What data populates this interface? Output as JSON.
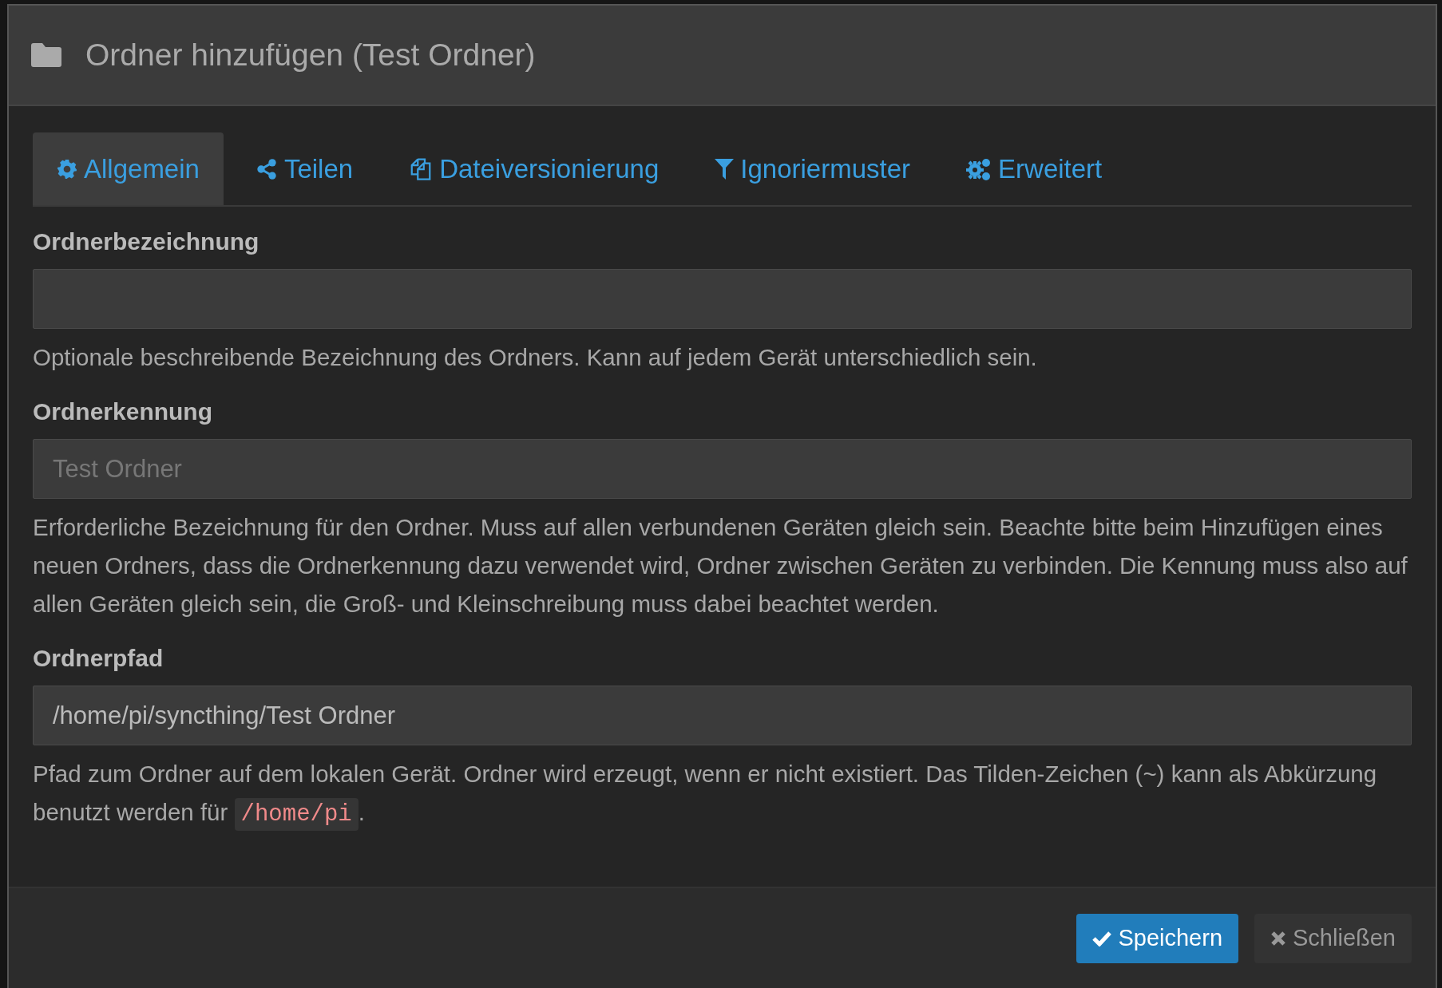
{
  "dialog": {
    "title": "Ordner hinzufügen (Test Ordner)"
  },
  "tabs": [
    {
      "label": "Allgemein",
      "kind": "gear",
      "selected": true
    },
    {
      "label": "Teilen",
      "kind": "share",
      "selected": false
    },
    {
      "label": "Dateiversionierung",
      "kind": "copies",
      "selected": false
    },
    {
      "label": "Ignoriermuster",
      "kind": "filter",
      "selected": false
    },
    {
      "label": "Erweitert",
      "kind": "gears",
      "selected": false
    }
  ],
  "fields": [
    {
      "label": "Ordnerbezeichnung",
      "help": "Optionale beschreibende Bezeichnung des Ordners. Kann auf jedem Gerät unterschiedlich sein."
    },
    {
      "label": "Ordnerkennung",
      "placeholder": "Test Ordner",
      "help": "Erforderliche Bezeichnung für den Ordner. Muss auf allen verbundenen Geräten gleich sein. Beachte bitte beim Hinzufügen eines neuen Ordners, dass die Ordnerkennung dazu verwendet wird, Ordner zwischen Geräten zu verbinden. Die Kennung muss also auf allen Geräten gleich sein, die Groß- und Kleinschreibung muss dabei beachtet werden."
    },
    {
      "label": "Ordnerpfad",
      "value": "/home/pi/syncthing/Test Ordner",
      "help": "Pfad zum Ordner auf dem lokalen Gerät. Ordner wird erzeugt, wenn er nicht existiert. Das Tilden-Zeichen (~) kann als Abkürzung benutzt werden für ",
      "help_code": "/home/pi",
      "help_end": "."
    }
  ],
  "buttons": [
    {
      "label": "Speichern",
      "kind": "primary"
    },
    {
      "label": "Schließen",
      "kind": "default"
    }
  ]
}
